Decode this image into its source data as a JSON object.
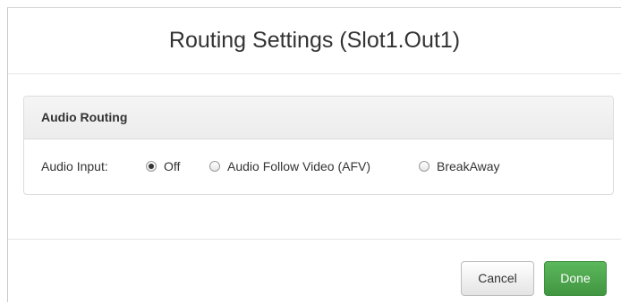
{
  "dialog": {
    "title": "Routing Settings (Slot1.Out1)"
  },
  "panel": {
    "heading": "Audio Routing",
    "field_label": "Audio Input:",
    "options": [
      {
        "label": "Off",
        "checked": true
      },
      {
        "label": "Audio Follow Video (AFV)",
        "checked": false
      },
      {
        "label": "BreakAway",
        "checked": false
      }
    ]
  },
  "footer": {
    "cancel_label": "Cancel",
    "done_label": "Done"
  },
  "colors": {
    "done_button": "#5cb85c",
    "text": "#333333"
  }
}
